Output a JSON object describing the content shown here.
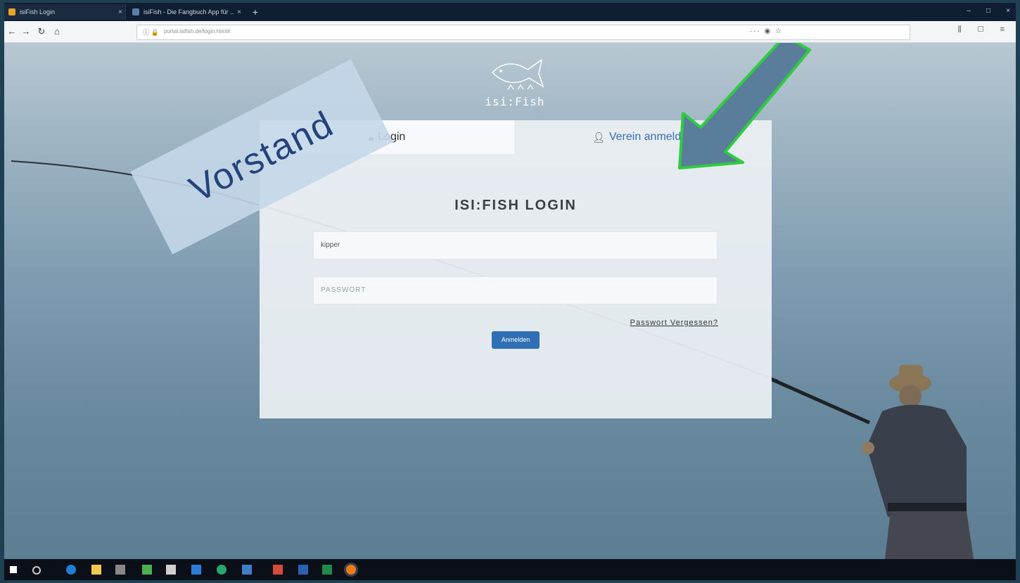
{
  "browser": {
    "tabs": [
      {
        "title": "isiFish Login",
        "active": true
      },
      {
        "title": "isiFish - Die Fangbuch App für ..."
      }
    ],
    "new_tab": "+",
    "url": "portal.isifish.de/login.html#",
    "window_controls": [
      "–",
      "□",
      "×"
    ]
  },
  "logo": {
    "text": "isi:Fish"
  },
  "login": {
    "tab_login": "Login",
    "tab_verein": "Verein anmelden",
    "heading": "ISI:FISH LOGIN",
    "username_value": "kipper",
    "password_placeholder": "PASSWORT",
    "forgot_link": "Passwort Vergessen?",
    "submit_label": "Anmelden"
  },
  "annotation": {
    "banner_text": "Vorstand",
    "arrow_color": "#2ecc40",
    "arrow_fill": "#5a7d9c"
  },
  "colors": {
    "accent": "#2f6fb3",
    "link": "#3a6fb2"
  }
}
